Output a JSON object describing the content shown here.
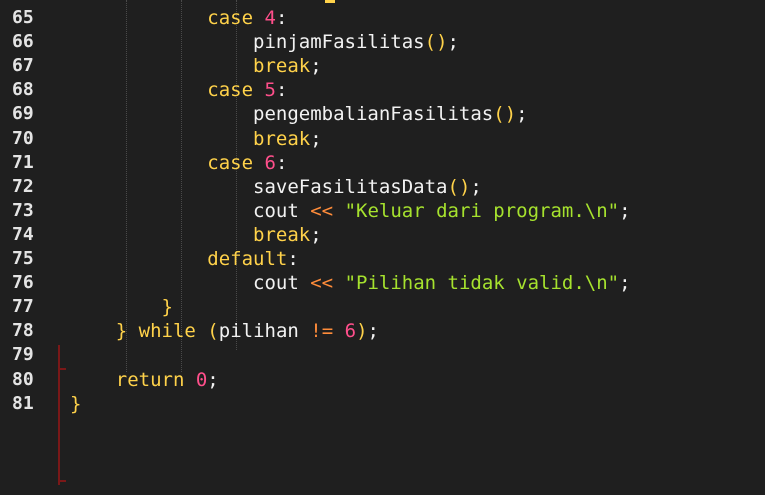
{
  "editor": {
    "line_numbers": [
      "65",
      "66",
      "67",
      "68",
      "69",
      "70",
      "71",
      "72",
      "73",
      "74",
      "75",
      "76",
      "77",
      "78",
      "79",
      "80",
      "81"
    ],
    "lines": [
      {
        "indent": "            ",
        "tokens": [
          {
            "t": "case ",
            "c": "kw"
          },
          {
            "t": "4",
            "c": "num"
          },
          {
            "t": ":",
            "c": "punc"
          }
        ]
      },
      {
        "indent": "                ",
        "tokens": [
          {
            "t": "pinjamFasilitas",
            "c": "id"
          },
          {
            "t": "()",
            "c": "paren"
          },
          {
            "t": ";",
            "c": "punc"
          }
        ]
      },
      {
        "indent": "                ",
        "tokens": [
          {
            "t": "break",
            "c": "kw"
          },
          {
            "t": ";",
            "c": "punc"
          }
        ]
      },
      {
        "indent": "            ",
        "tokens": [
          {
            "t": "case ",
            "c": "kw"
          },
          {
            "t": "5",
            "c": "num"
          },
          {
            "t": ":",
            "c": "punc"
          }
        ]
      },
      {
        "indent": "                ",
        "tokens": [
          {
            "t": "pengembalianFasilitas",
            "c": "id"
          },
          {
            "t": "()",
            "c": "paren"
          },
          {
            "t": ";",
            "c": "punc"
          }
        ]
      },
      {
        "indent": "                ",
        "tokens": [
          {
            "t": "break",
            "c": "kw"
          },
          {
            "t": ";",
            "c": "punc"
          }
        ]
      },
      {
        "indent": "            ",
        "tokens": [
          {
            "t": "case ",
            "c": "kw"
          },
          {
            "t": "6",
            "c": "num"
          },
          {
            "t": ":",
            "c": "punc"
          }
        ]
      },
      {
        "indent": "                ",
        "tokens": [
          {
            "t": "saveFasilitasData",
            "c": "id"
          },
          {
            "t": "()",
            "c": "paren"
          },
          {
            "t": ";",
            "c": "punc"
          }
        ]
      },
      {
        "indent": "                ",
        "tokens": [
          {
            "t": "cout ",
            "c": "id"
          },
          {
            "t": "<<",
            "c": "op"
          },
          {
            "t": " ",
            "c": "punc"
          },
          {
            "t": "\"Keluar dari program.\\n\"",
            "c": "str"
          },
          {
            "t": ";",
            "c": "punc"
          }
        ]
      },
      {
        "indent": "                ",
        "tokens": [
          {
            "t": "break",
            "c": "kw"
          },
          {
            "t": ";",
            "c": "punc"
          }
        ]
      },
      {
        "indent": "            ",
        "tokens": [
          {
            "t": "default",
            "c": "kw"
          },
          {
            "t": ":",
            "c": "punc"
          }
        ]
      },
      {
        "indent": "                ",
        "tokens": [
          {
            "t": "cout ",
            "c": "id"
          },
          {
            "t": "<<",
            "c": "op"
          },
          {
            "t": " ",
            "c": "punc"
          },
          {
            "t": "\"Pilihan tidak valid.\\n\"",
            "c": "str"
          },
          {
            "t": ";",
            "c": "punc"
          }
        ]
      },
      {
        "indent": "        ",
        "tokens": [
          {
            "t": "}",
            "c": "brace-red"
          }
        ]
      },
      {
        "indent": "    ",
        "tokens": [
          {
            "t": "} ",
            "c": "brace-red"
          },
          {
            "t": "while ",
            "c": "kw"
          },
          {
            "t": "(",
            "c": "paren"
          },
          {
            "t": "pilihan ",
            "c": "id"
          },
          {
            "t": "!=",
            "c": "op"
          },
          {
            "t": " ",
            "c": "punc"
          },
          {
            "t": "6",
            "c": "num"
          },
          {
            "t": ")",
            "c": "paren"
          },
          {
            "t": ";",
            "c": "punc"
          }
        ]
      },
      {
        "indent": "",
        "tokens": []
      },
      {
        "indent": "    ",
        "tokens": [
          {
            "t": "return ",
            "c": "kw"
          },
          {
            "t": "0",
            "c": "num"
          },
          {
            "t": ";",
            "c": "punc"
          }
        ]
      },
      {
        "indent": "",
        "tokens": [
          {
            "t": "}",
            "c": "brace-red"
          }
        ]
      }
    ]
  },
  "colors": {
    "background": "#1f1f1f",
    "keyword": "#ffd24a",
    "number": "#ff4f8b",
    "string": "#a6e22e",
    "operator": "#ff8c3a",
    "fold_marker": "#7a1818"
  }
}
